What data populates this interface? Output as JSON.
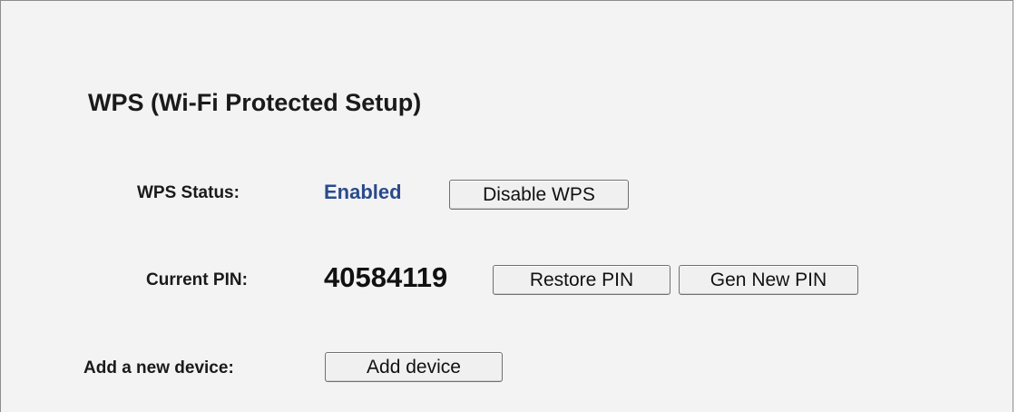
{
  "wps": {
    "title": "WPS (Wi-Fi Protected Setup)",
    "status_label": "WPS Status:",
    "status_value": "Enabled",
    "status_color": "#2a4a8c",
    "disable_button": "Disable WPS",
    "pin_label": "Current PIN:",
    "pin_value": "40584119",
    "restore_pin_button": "Restore PIN",
    "gen_new_pin_button": "Gen New PIN",
    "add_device_label": "Add a new device:",
    "add_device_button": "Add device"
  }
}
